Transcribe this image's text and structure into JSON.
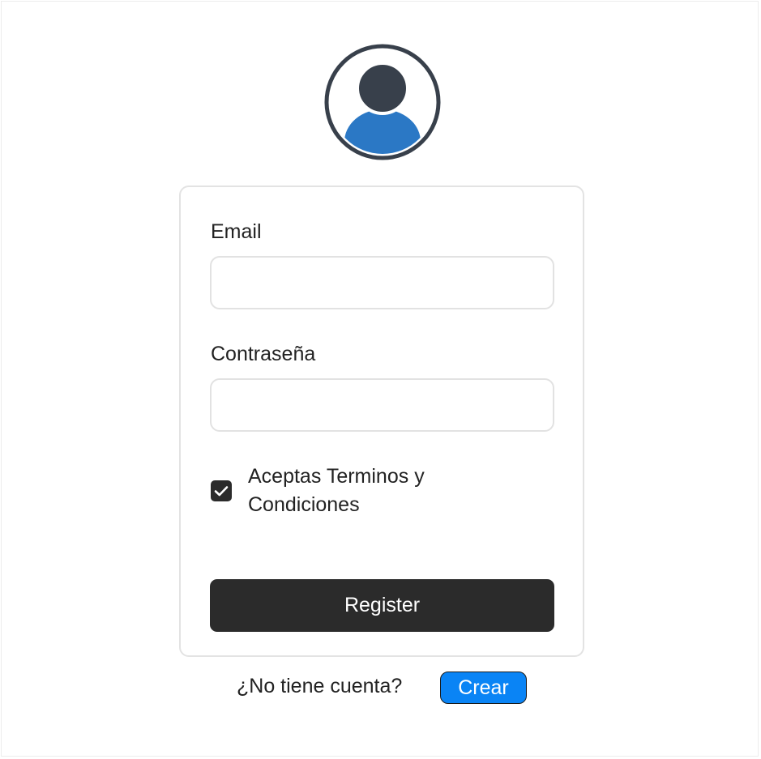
{
  "avatar": {
    "icon": "user-avatar-icon",
    "ring_color": "#38404b",
    "head_color": "#38404b",
    "body_color": "#2b78c5"
  },
  "form": {
    "email_label": "Email",
    "email_value": "",
    "email_placeholder": "",
    "password_label": "Contraseña",
    "password_value": "",
    "password_placeholder": "",
    "terms_label": "Aceptas Terminos y Condiciones",
    "terms_checked": true,
    "register_label": "Register"
  },
  "footer": {
    "question": "¿No tiene cuenta?",
    "create_label": "Crear"
  },
  "colors": {
    "primary_dark": "#2b2b2b",
    "accent_blue": "#0a84f5",
    "border": "#e3e3e3"
  }
}
